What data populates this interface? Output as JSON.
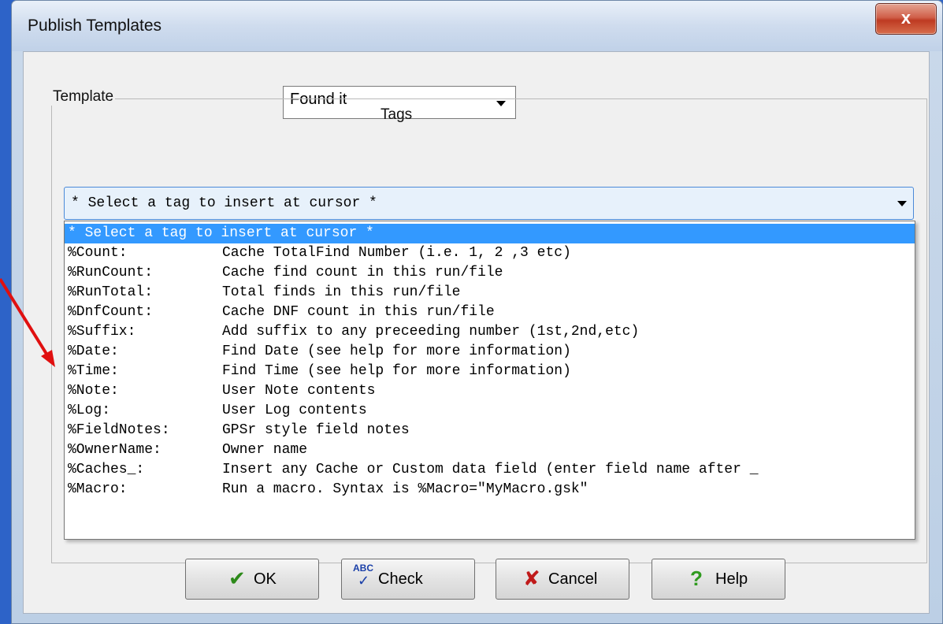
{
  "window": {
    "title": "Publish Templates",
    "close_label": "x"
  },
  "type_dropdown": {
    "value": "Found it"
  },
  "template_group": {
    "label": "Template",
    "tags_label": "Tags"
  },
  "tag_dropdown": {
    "value": "* Select a tag to insert at cursor *"
  },
  "tag_list": [
    {
      "name": "* Select a tag to insert at cursor *",
      "desc": "",
      "selected": true
    },
    {
      "name": "%Count:",
      "desc": "Cache TotalFind Number (i.e. 1, 2 ,3 etc)"
    },
    {
      "name": "%RunCount:",
      "desc": "Cache find count in this run/file"
    },
    {
      "name": "%RunTotal:",
      "desc": "Total finds in this run/file"
    },
    {
      "name": "%DnfCount:",
      "desc": "Cache DNF count in this run/file"
    },
    {
      "name": "%Suffix:",
      "desc": "Add suffix to any preceeding number (1st,2nd,etc)"
    },
    {
      "name": "%Date:",
      "desc": "Find Date (see help for more information)"
    },
    {
      "name": "%Time:",
      "desc": "Find Time (see help for more information)"
    },
    {
      "name": "%Note:",
      "desc": "User Note contents"
    },
    {
      "name": "%Log:",
      "desc": "User Log contents"
    },
    {
      "name": "%FieldNotes:",
      "desc": "GPSr style field notes"
    },
    {
      "name": "%OwnerName:",
      "desc": "Owner name"
    },
    {
      "name": "%Caches_:",
      "desc": "Insert any Cache or Custom data field (enter field name after _"
    },
    {
      "name": "%Macro:",
      "desc": "Run a macro. Syntax is %Macro=\"MyMacro.gsk\""
    }
  ],
  "buttons": {
    "ok": "OK",
    "check": "Check",
    "cancel": "Cancel",
    "help": "Help"
  },
  "colors": {
    "selection": "#3399ff",
    "annotation_arrow": "#e01010"
  }
}
